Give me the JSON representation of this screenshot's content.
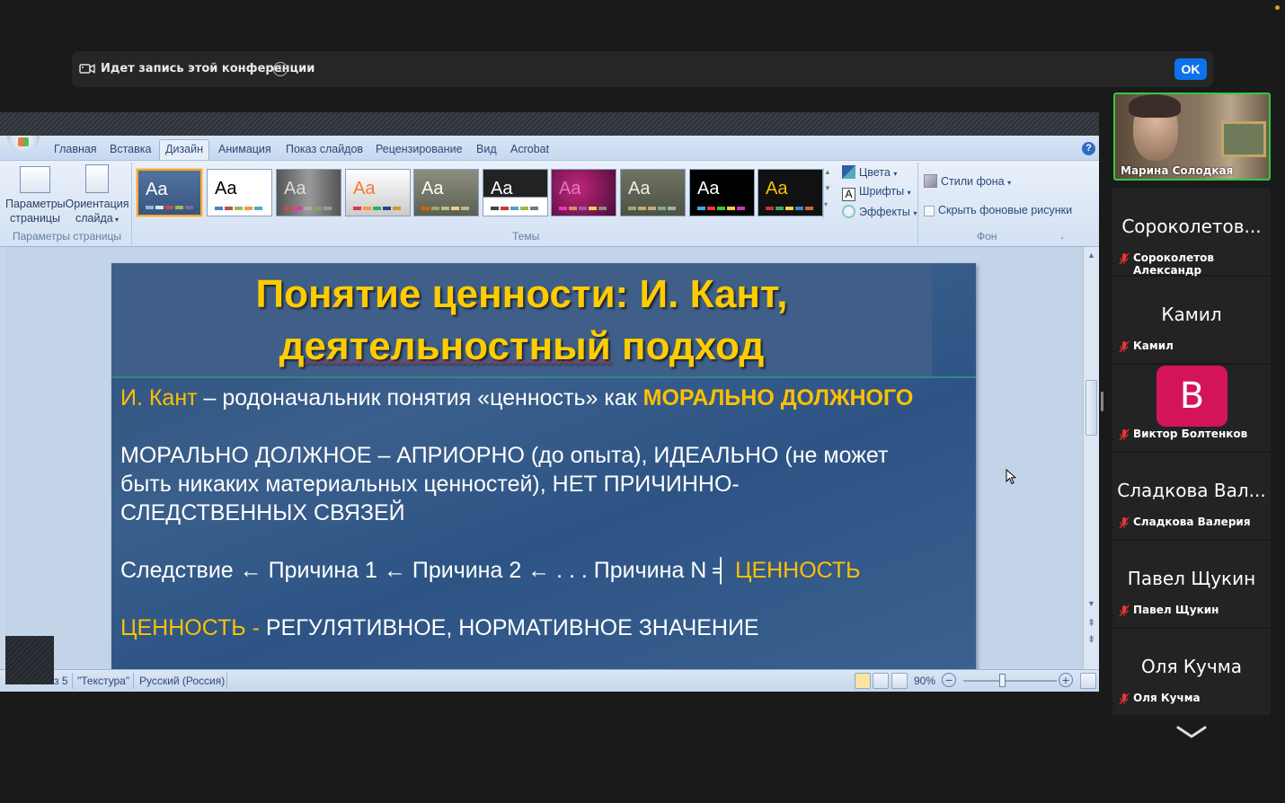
{
  "recording": {
    "text": "Идет запись этой конференции",
    "info": "i",
    "ok_label": "OK"
  },
  "ribbon": {
    "tabs": [
      "Главная",
      "Вставка",
      "Дизайн",
      "Анимация",
      "Показ слайдов",
      "Рецензирование",
      "Вид",
      "Acrobat"
    ],
    "active_tab": "Дизайн",
    "page_setup": {
      "btn1": "Параметры страницы",
      "btn2": "Ориентация слайда",
      "group": "Параметры страницы"
    },
    "themes_group": "Темы",
    "theme_sample": "Aa",
    "options": {
      "colors": "Цвета",
      "fonts": "Шрифты",
      "effects": "Эффекты"
    },
    "background": {
      "styles": "Стили фона",
      "hide": "Скрыть фоновые рисунки",
      "group": "Фон"
    },
    "help": "?"
  },
  "slide": {
    "title_line1": "Понятие ценности: И. Кант,",
    "title_line2_a": "деятельностный",
    "title_line2_b": " подход",
    "p1_name": "И. Кант",
    "p1_text": " – родоначальник понятия «ценность» как ",
    "p1_em": "МОРАЛЬНО ДОЛЖНОГО",
    "p2_line1": "МОРАЛЬНО ДОЛЖНОЕ – АПРИОРНО (до опыта), ИДЕАЛЬНО (не может",
    "p2_line2": "быть никаких материальных ценностей), НЕТ ПРИЧИННО-",
    "p2_line3": "СЛЕДСТВЕННЫХ СВЯЗЕЙ",
    "p3_text": "Следствие ← Причина 1 ←  Причина 2 ← . . .  Причина N  ╡ ",
    "p3_em": "ЦЕННОСТЬ",
    "p4_em": "ЦЕННОСТЬ - ",
    "p4_text": "РЕГУЛЯТИВНОЕ, НОРМАТИВНОЕ ЗНАЧЕНИЕ"
  },
  "status": {
    "slide": "з 5",
    "theme": "\"Текстура\"",
    "lang": "Русский (Россия)",
    "zoom": "90%"
  },
  "participants": {
    "video": {
      "name": "Марина Солодкая"
    },
    "tiles": [
      {
        "display": "Сороколетов...",
        "full": "Сороколетов Александр"
      },
      {
        "display": "Камил",
        "full": "Камил"
      },
      {
        "display": "В",
        "full": "Виктор Болтенков"
      },
      {
        "display": "Сладкова Вал...",
        "full": "Сладкова Валерия"
      },
      {
        "display": "Павел Щукин",
        "full": "Павел Щукин"
      },
      {
        "display": "Оля Кучма",
        "full": "Оля Кучма"
      }
    ]
  },
  "colors": {
    "ok_blue": "#0e72ed",
    "avatar_pink": "#d4145a",
    "slide_yellow": "#ffc000",
    "active_speaker": "#2ecc40"
  }
}
